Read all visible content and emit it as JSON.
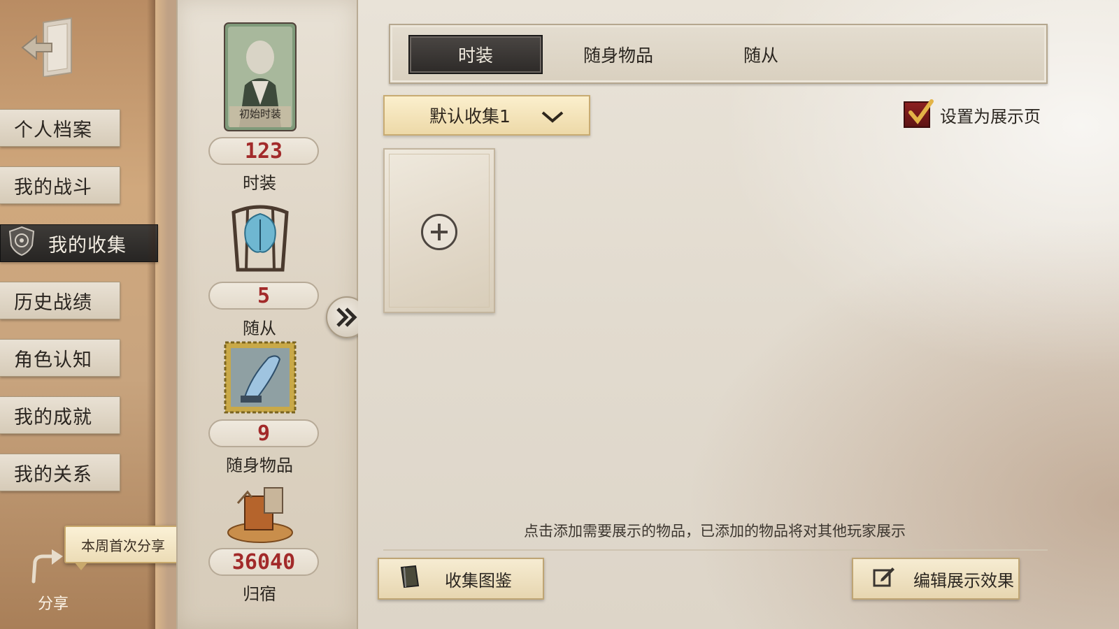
{
  "sidebar": {
    "items": [
      {
        "label": "个人档案",
        "active": false
      },
      {
        "label": "我的战斗",
        "active": false
      },
      {
        "label": "我的收集",
        "active": true
      },
      {
        "label": "历史战绩",
        "active": false
      },
      {
        "label": "角色认知",
        "active": false
      },
      {
        "label": "我的成就",
        "active": false
      },
      {
        "label": "我的关系",
        "active": false
      }
    ],
    "share_label": "分享",
    "share_tooltip": "本周首次分享"
  },
  "stats": [
    {
      "count": "123",
      "label": "时装",
      "thumb_caption": "初始时装"
    },
    {
      "count": "5",
      "label": "随从"
    },
    {
      "count": "9",
      "label": "随身物品"
    },
    {
      "count": "36040",
      "label": "归宿"
    }
  ],
  "tabs": [
    {
      "label": "时装",
      "active": true
    },
    {
      "label": "随身物品",
      "active": false
    },
    {
      "label": "随从",
      "active": false
    }
  ],
  "collection_select": {
    "value": "默认收集1"
  },
  "showcase": {
    "label": "设置为展示页",
    "checked": true
  },
  "hint": "点击添加需要展示的物品，已添加的物品将对其他玩家展示",
  "buttons": {
    "catalog": "收集图鉴",
    "edit_display": "编辑展示效果"
  },
  "colors": {
    "count_red": "#a22a2a",
    "active_tab": "#2d2a28",
    "dropdown_gold": "#edd9a8",
    "checkbox_red": "#8c2020"
  }
}
